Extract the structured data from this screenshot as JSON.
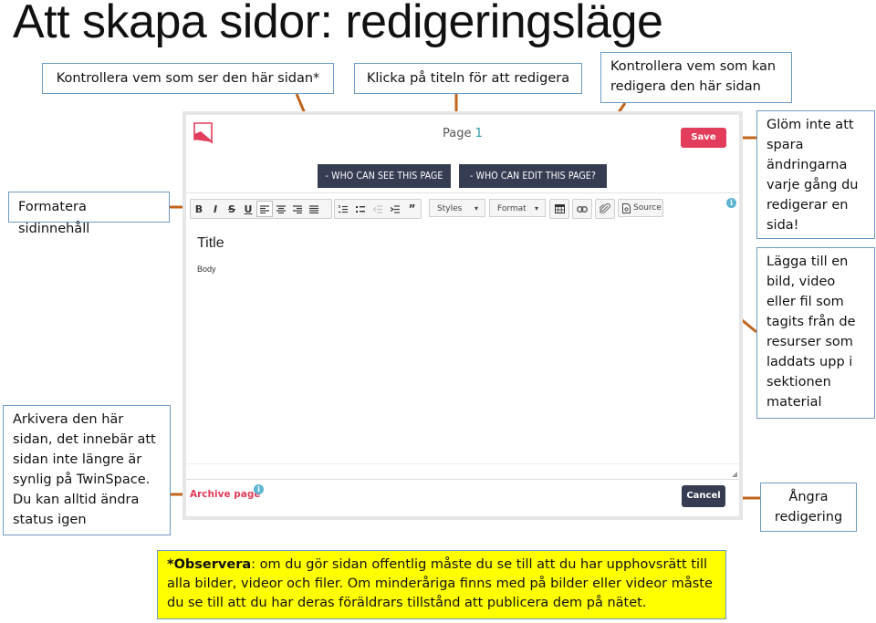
{
  "slide": {
    "title": "Att skapa sidor: redigeringsläge"
  },
  "callouts": {
    "who_sees": "Kontrollera vem som ser den här sidan*",
    "click_title": "Klicka på titeln för att redigera",
    "who_edits": "Kontrollera vem som kan redigera den här sidan",
    "format": "Formatera sidinnehåll",
    "archive": "Arkivera den här sidan, det innebär att sidan inte längre är synlig på TwinSpace. Du kan alltid ändra status igen",
    "save_reminder": "Glöm inte att spara ändringarna varje gång du redigerar en sida!",
    "attach": "Lägga till en bild, video eller fil som tagits från de resurser som laddats upp i sektionen material",
    "undo": "Ångra redigering"
  },
  "editor": {
    "page_title_prefix": "Page ",
    "page_number": "1",
    "save_label": "Save",
    "who_can_see_label": "- WHO CAN SEE THIS PAGE",
    "who_can_edit_label": "- WHO CAN EDIT THIS PAGE?",
    "toolbar": {
      "format_buttons": [
        "B",
        "I",
        "S",
        "U"
      ],
      "styles_label": "Styles",
      "format_label": "Format",
      "source_label": "Source"
    },
    "content_title": "Title",
    "content_body": "Body",
    "archive_label": "Archive page",
    "cancel_label": "Cancel"
  },
  "note": {
    "bold_prefix": "*Observera",
    "text": ": om du gör sidan offentlig måste du se till att du har upphovsrätt till alla bilder, videor och filer. Om minderåriga finns med på bilder eller videor måste du se till att du har deras föräldrars tillstånd att publicera dem på nätet."
  },
  "colors": {
    "connector": "#c0641c",
    "callout_border": "#6d9bc3",
    "accent_red": "#e23d5a",
    "dark_button": "#363d52",
    "note_bg": "#ffff00"
  }
}
